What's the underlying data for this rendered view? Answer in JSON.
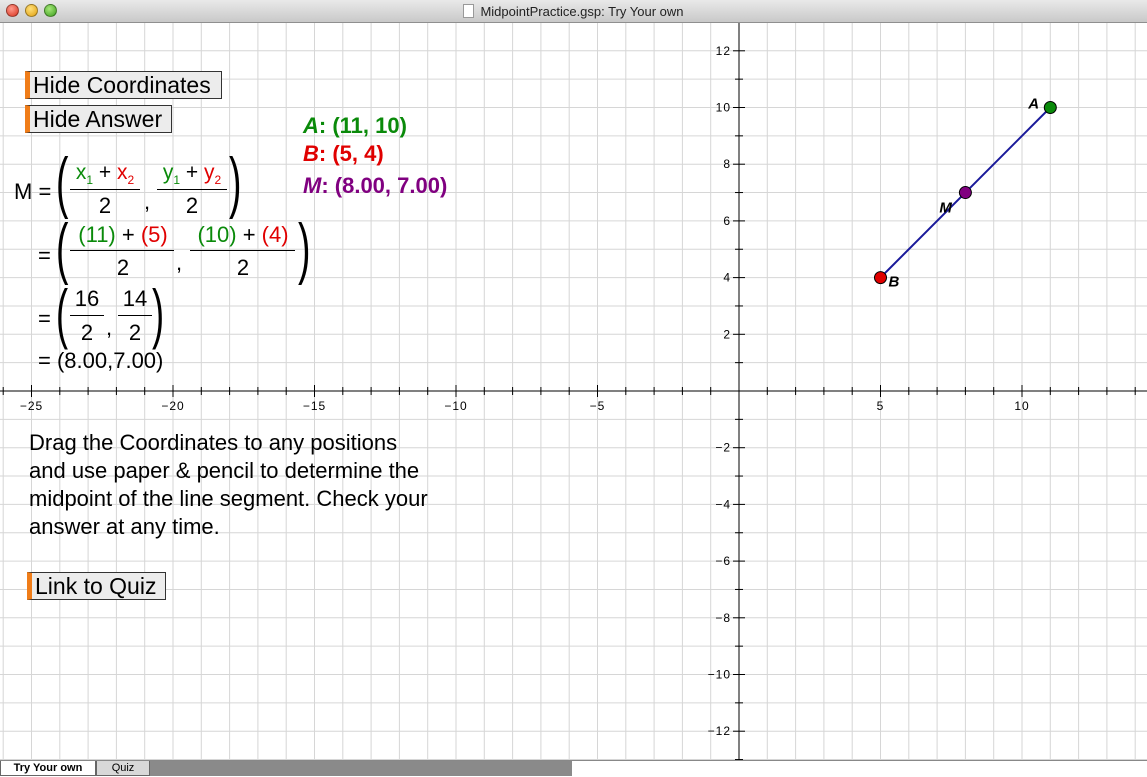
{
  "window": {
    "title": "MidpointPractice.gsp: Try Your own"
  },
  "buttons": {
    "hide_coordinates": "Hide Coordinates",
    "hide_answer": "Hide Answer",
    "link_to_quiz": "Link to Quiz"
  },
  "coordinates": {
    "A": {
      "name": "A",
      "value": ": (11, 10)",
      "color": "#0a8a0a"
    },
    "B": {
      "name": "B",
      "value": ": (5, 4)",
      "color": "#e00000"
    },
    "M": {
      "name": "M",
      "value": ": (8.00, 7.00)",
      "color": "#800080"
    }
  },
  "calculation": {
    "m_eq": "M =",
    "eq": "=",
    "comma": ",",
    "x1": "x",
    "x1_sub": "1",
    "plus": " + ",
    "x2": "x",
    "x2_sub": "2",
    "y1": "y",
    "y1_sub": "1",
    "y2": "y",
    "y2_sub": "2",
    "two": "2",
    "sub_x_a": "(11)",
    "sub_x_b": "(5)",
    "sub_y_a": "(10)",
    "sub_y_b": "(4)",
    "num_x": "16",
    "num_y": "14",
    "result": "= (8.00,7.00)"
  },
  "instructions": "Drag the Coordinates to any positions and use paper & pencil to determine the midpoint of the line segment. Check your answer at any time.",
  "tabs": [
    {
      "label": "Try Your own",
      "active": true
    },
    {
      "label": "Quiz",
      "active": false
    }
  ],
  "graph": {
    "x_ticks": [
      -25,
      -20,
      -15,
      -10,
      -5,
      5,
      10
    ],
    "y_ticks": [
      -12,
      -10,
      -8,
      -6,
      -4,
      -2,
      2,
      4,
      6,
      8,
      10,
      12
    ],
    "x_tick_labels": [
      "−25",
      "−20",
      "−15",
      "−10",
      "−5",
      "5",
      "10"
    ],
    "y_tick_labels": [
      "−12",
      "−10",
      "−8",
      "−6",
      "−4",
      "−2",
      "2",
      "4",
      "6",
      "8",
      "10",
      "12"
    ],
    "points": [
      {
        "label": "A",
        "x": 11,
        "y": 10,
        "color": "#0a8a0a"
      },
      {
        "label": "B",
        "x": 5,
        "y": 4,
        "color": "#e00000"
      },
      {
        "label": "M",
        "x": 8,
        "y": 7,
        "color": "#800080"
      }
    ],
    "segment_color": "#1a1a9a"
  },
  "colors": {
    "accent": "#f07d19",
    "grid": "#d6d6d6",
    "axis": "#000000"
  },
  "icons": [
    "close-icon",
    "minimize-icon",
    "zoom-icon",
    "document-icon"
  ]
}
